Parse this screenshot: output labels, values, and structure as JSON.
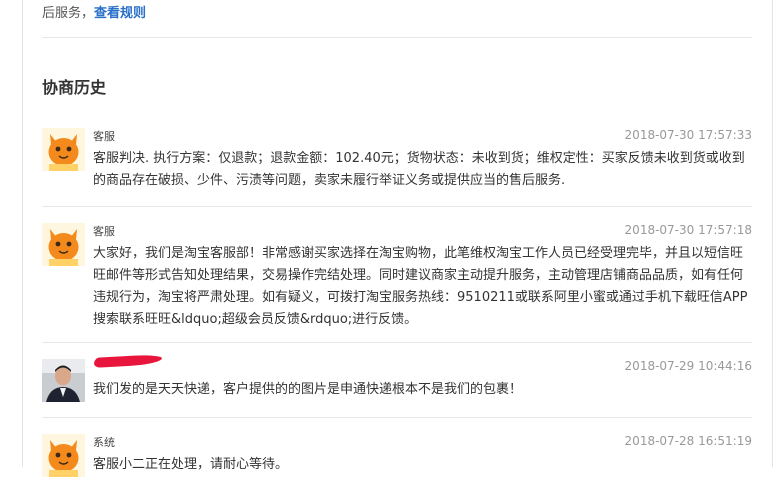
{
  "header": {
    "note_text": "后服务，",
    "rules_link": "查看规则"
  },
  "history": {
    "title": "协商历史",
    "entries": [
      {
        "author": "客服",
        "time": "2018-07-30 17:57:33",
        "avatar": "taobao-mascot-icon",
        "message": "客服判决. 执行方案：仅退款；退款金额：102.40元；货物状态：未收到货；维权定性：买家反馈未收到货或收到的商品存在破损、少件、污渍等问题，卖家未履行举证义务或提供应当的售后服务."
      },
      {
        "author": "客服",
        "time": "2018-07-30 17:57:18",
        "avatar": "taobao-mascot-icon",
        "message": "大家好，我们是淘宝客服部！非常感谢买家选择在淘宝购物，此笔维权淘宝工作人员已经受理完毕，并且以短信旺旺邮件等形式告知处理结果，交易操作完结处理。同时建议商家主动提升服务，主动管理店铺商品品质，如有任何违规行为，淘宝将严肃处理。如有疑义，可拨打淘宝服务热线：9510211或联系阿里小蜜或通过手机下载旺信APP搜索联系旺旺&ldquo;超级会员反馈&rdquo;进行反馈。"
      },
      {
        "author": "",
        "time": "2018-07-29 10:44:16",
        "avatar": "user-photo-avatar",
        "message": "我们发的是天天快递，客户提供的的图片是申通快递根本不是我们的包裹！"
      },
      {
        "author": "系统",
        "time": "2018-07-28 16:51:19",
        "avatar": "taobao-mascot-icon",
        "message": "客服小二正在处理，请耐心等待。"
      }
    ]
  },
  "colors": {
    "link": "#2a6fc9",
    "mascot_orange": "#f48a1b",
    "redaction": "#e8163c"
  }
}
